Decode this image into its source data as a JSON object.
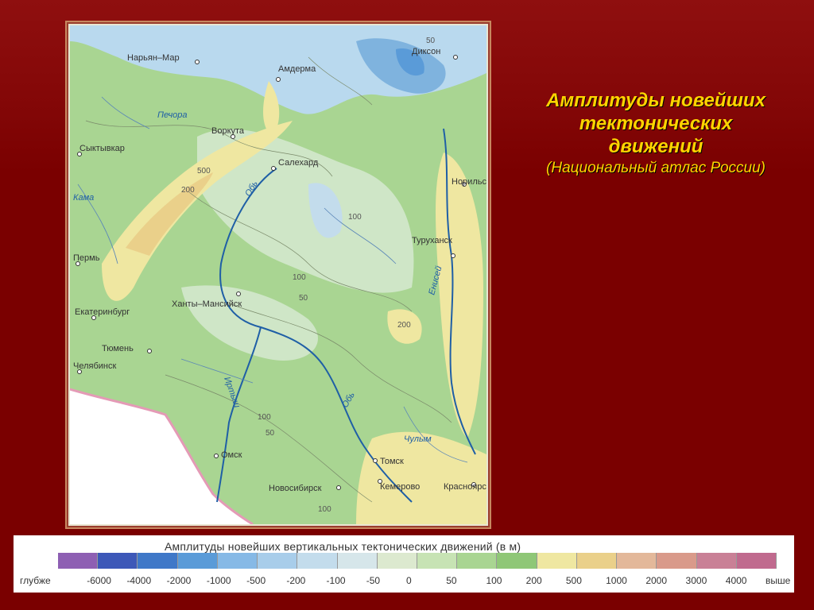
{
  "slide": {
    "title_lines": [
      "Амплитуды новейших",
      "тектонических",
      "движений"
    ],
    "subtitle": "(Национальный атлас России)"
  },
  "map": {
    "cities": [
      "Нарьян–Мар",
      "Амдерма",
      "Диксон",
      "Воркута",
      "Сыктывкар",
      "Салехард",
      "Норильск",
      "Туруханск",
      "Пермь",
      "Ханты–Мансийск",
      "Екатеринбург",
      "Тюмень",
      "Челябинск",
      "Омск",
      "Томск",
      "Новосибирск",
      "Кемерово",
      "Красноярск"
    ],
    "rivers": [
      "Обь",
      "Енисей",
      "Иртыш",
      "Печора",
      "Кама",
      "Чулым",
      "Обь"
    ],
    "contours": [
      "500",
      "200",
      "100",
      "50",
      "100",
      "200",
      "100",
      "50",
      "50",
      "100"
    ],
    "colors": {
      "sea": "#b9d9ee",
      "deep": "#7fb3de",
      "low": "#cfe6c7",
      "mid": "#9fcf8d",
      "high": "#f0e6a4",
      "higher": "#e8c98a",
      "river": "#1f5fa6"
    }
  },
  "legend": {
    "title": "Амплитуды новейших вертикальных тектонических движений (в м)",
    "left_label": "глубже",
    "right_label": "выше",
    "ticks": [
      "-6000",
      "-4000",
      "-2000",
      "-1000",
      "-500",
      "-200",
      "-100",
      "-50",
      "0",
      "50",
      "100",
      "200",
      "500",
      "1000",
      "2000",
      "3000",
      "4000"
    ],
    "swatch_colors": [
      "#8e5fb3",
      "#3d58b8",
      "#3f78c8",
      "#5a9bd8",
      "#86b9e6",
      "#a8cdea",
      "#c3dcec",
      "#d6e6ea",
      "#dce9cf",
      "#c7e3b4",
      "#a9d592",
      "#8fc777",
      "#efe7a1",
      "#ead08a",
      "#e3b89a",
      "#d99a8a",
      "#c98096",
      "#c06a8e"
    ]
  }
}
